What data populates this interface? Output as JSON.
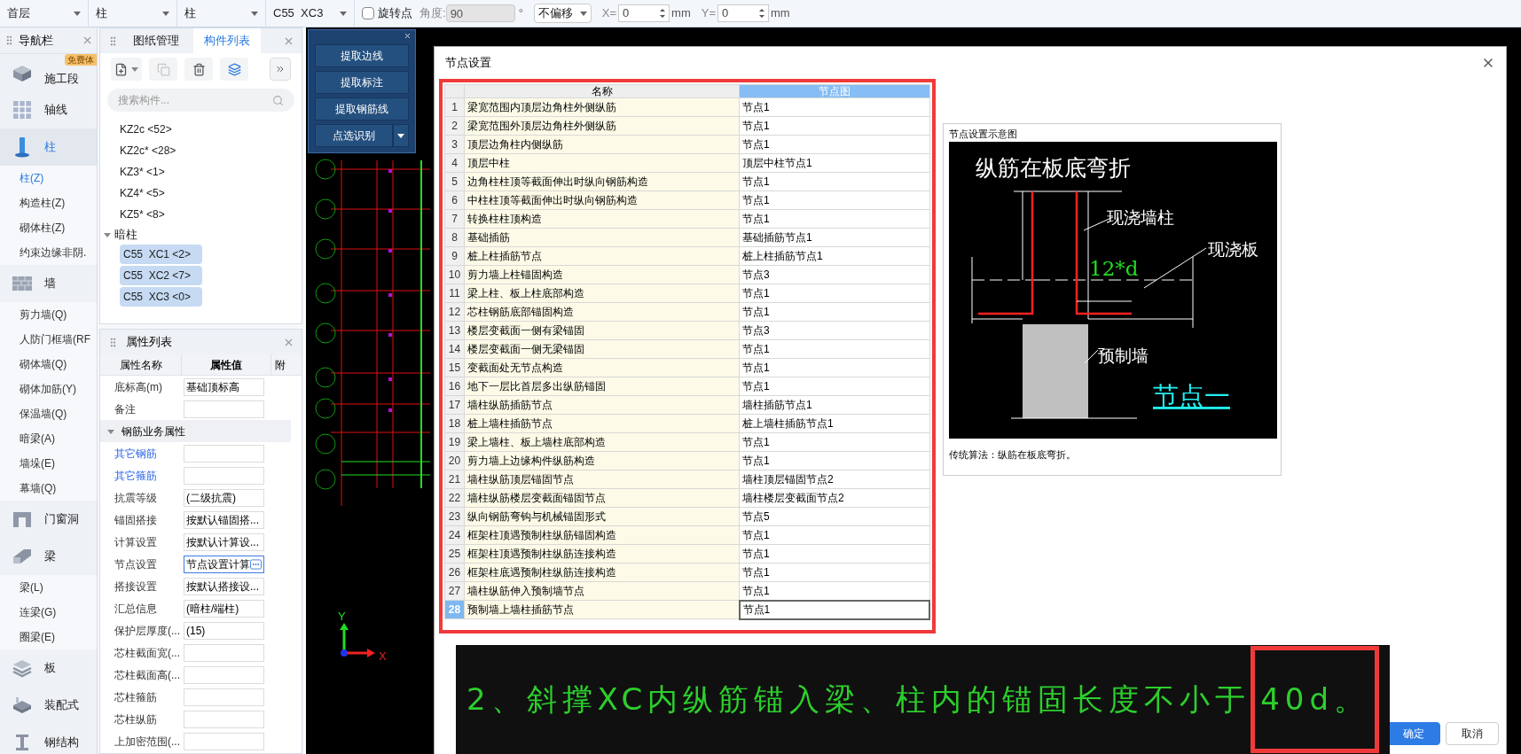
{
  "toolbar": {
    "dropdowns": [
      {
        "value": "首层"
      },
      {
        "value": "柱"
      },
      {
        "value": "柱"
      },
      {
        "value": "C55  XC3"
      }
    ],
    "rotate": {
      "label": "旋转点",
      "checked": false
    },
    "angle": {
      "label": "角度:",
      "value": "90",
      "disabled": true,
      "unit": "°"
    },
    "offset": {
      "value": "不偏移"
    },
    "coords": [
      {
        "label": "X=",
        "value": "0",
        "unit": "mm"
      },
      {
        "label": "Y=",
        "value": "0",
        "unit": "mm"
      }
    ]
  },
  "nav": {
    "title": "导航栏",
    "categories": [
      {
        "label": "施工段",
        "badge": "免费体",
        "selected": false
      },
      {
        "label": "轴线",
        "selected": false
      },
      {
        "label": "柱",
        "selected": true,
        "children": [
          {
            "label": "柱(Z)",
            "selected": true
          },
          {
            "label": "构造柱(Z)",
            "selected": false
          },
          {
            "label": "砌体柱(Z)",
            "selected": false
          },
          {
            "label": "约束边缘非阴.",
            "selected": false
          }
        ]
      },
      {
        "label": "墙",
        "selected": false,
        "children": [
          {
            "label": "剪力墙(Q)",
            "selected": false
          },
          {
            "label": "人防门框墙(RF",
            "selected": false
          },
          {
            "label": "砌体墙(Q)",
            "selected": false
          },
          {
            "label": "砌体加筋(Y)",
            "selected": false
          },
          {
            "label": "保温墙(Q)",
            "selected": false
          },
          {
            "label": "暗梁(A)",
            "selected": false
          },
          {
            "label": "墙垛(E)",
            "selected": false
          },
          {
            "label": "幕墙(Q)",
            "selected": false
          }
        ]
      },
      {
        "label": "门窗洞",
        "selected": false
      },
      {
        "label": "梁",
        "selected": false,
        "children": [
          {
            "label": "梁(L)",
            "selected": false
          },
          {
            "label": "连梁(G)",
            "selected": false
          },
          {
            "label": "圈梁(E)",
            "selected": false
          }
        ]
      },
      {
        "label": "板",
        "selected": false
      },
      {
        "label": "装配式",
        "selected": false
      },
      {
        "label": "钢结构",
        "selected": false
      }
    ]
  },
  "component_panel": {
    "tabs": [
      {
        "label": "图纸管理",
        "selected": false
      },
      {
        "label": "构件列表",
        "selected": true
      }
    ],
    "search": {
      "placeholder": "搜索构件..."
    },
    "items": [
      {
        "label": "KZ2c <52>"
      },
      {
        "label": "KZ2c* <28>"
      },
      {
        "label": "KZ3* <1>"
      },
      {
        "label": "KZ4* <5>"
      },
      {
        "label": "KZ5* <8>"
      }
    ],
    "groups": [
      {
        "label": "暗柱",
        "expanded": true,
        "children": [
          {
            "label": "C55  XC1 <2>",
            "selected": true
          },
          {
            "label": "C55  XC2 <7>",
            "selected": true
          },
          {
            "label": "C55  XC3 <0>",
            "selected": true
          }
        ]
      }
    ]
  },
  "properties": {
    "title": "属性列表",
    "columns": [
      "属性名称",
      "属性值",
      "附"
    ],
    "rows": [
      {
        "kind": "field",
        "name": "底标高(m)",
        "value": "基础顶标高",
        "link": false,
        "focused": false
      },
      {
        "kind": "field",
        "name": "备注",
        "link": false,
        "focused": false
      },
      {
        "kind": "group",
        "label": "钢筋业务属性",
        "expanded": true
      },
      {
        "kind": "field",
        "name": "其它钢筋",
        "link": true,
        "focused": false
      },
      {
        "kind": "field",
        "name": "其它箍筋",
        "link": true,
        "focused": false
      },
      {
        "kind": "field",
        "name": "抗震等级",
        "value": "(二级抗震)",
        "link": false,
        "focused": false
      },
      {
        "kind": "field",
        "name": "锚固搭接",
        "value": "按默认锚固搭...",
        "link": false,
        "focused": false
      },
      {
        "kind": "field",
        "name": "计算设置",
        "value": "按默认计算设...",
        "link": false,
        "focused": false
      },
      {
        "kind": "field",
        "name": "节点设置",
        "value": "节点设置计算",
        "link": false,
        "focused": true
      },
      {
        "kind": "field",
        "name": "搭接设置",
        "value": "按默认搭接设...",
        "link": false,
        "focused": false
      },
      {
        "kind": "field",
        "name": "汇总信息",
        "value": "(暗柱/端柱)",
        "link": false,
        "focused": false
      },
      {
        "kind": "field",
        "name": "保护层厚度(...",
        "value": "(15)",
        "link": false,
        "focused": false
      },
      {
        "kind": "field",
        "name": "芯柱截面宽(...",
        "link": false,
        "focused": false
      },
      {
        "kind": "field",
        "name": "芯柱截面高(...",
        "link": false,
        "focused": false
      },
      {
        "kind": "field",
        "name": "芯柱箍筋",
        "link": false,
        "focused": false
      },
      {
        "kind": "field",
        "name": "芯柱纵筋",
        "link": false,
        "focused": false
      },
      {
        "kind": "field",
        "name": "上加密范围(...",
        "link": false,
        "focused": false
      }
    ]
  },
  "toolbox": {
    "buttons": [
      {
        "label": "提取边线",
        "kind": "plain"
      },
      {
        "label": "提取标注",
        "kind": "plain"
      },
      {
        "label": "提取钢筋线",
        "kind": "plain"
      },
      {
        "label": "点选识别",
        "kind": "split"
      }
    ]
  },
  "canvas": {
    "axis_labels": [
      "Y",
      "X"
    ]
  },
  "dialog": {
    "title": "节点设置",
    "table": {
      "columns": [
        "名称",
        "节点图"
      ],
      "rows": [
        {
          "number": "1",
          "name": "梁宽范围内顶层边角柱外侧纵筋",
          "node": "节点1",
          "selected": false
        },
        {
          "number": "2",
          "name": "梁宽范围外顶层边角柱外侧纵筋",
          "node": "节点1",
          "selected": false
        },
        {
          "number": "3",
          "name": "顶层边角柱内侧纵筋",
          "node": "节点1",
          "selected": false
        },
        {
          "number": "4",
          "name": "顶层中柱",
          "node": "顶层中柱节点1",
          "selected": false
        },
        {
          "number": "5",
          "name": "边角柱柱顶等截面伸出时纵向钢筋构造",
          "node": "节点1",
          "selected": false
        },
        {
          "number": "6",
          "name": "中柱柱顶等截面伸出时纵向钢筋构造",
          "node": "节点1",
          "selected": false
        },
        {
          "number": "7",
          "name": "转换柱柱顶构造",
          "node": "节点1",
          "selected": false
        },
        {
          "number": "8",
          "name": "基础插筋",
          "node": "基础插筋节点1",
          "selected": false
        },
        {
          "number": "9",
          "name": "桩上柱插筋节点",
          "node": "桩上柱插筋节点1",
          "selected": false
        },
        {
          "number": "10",
          "name": "剪力墙上柱锚固构造",
          "node": "节点3",
          "selected": false
        },
        {
          "number": "11",
          "name": "梁上柱、板上柱底部构造",
          "node": "节点1",
          "selected": false
        },
        {
          "number": "12",
          "name": "芯柱钢筋底部锚固构造",
          "node": "节点1",
          "selected": false
        },
        {
          "number": "13",
          "name": "楼层变截面一侧有梁锚固",
          "node": "节点3",
          "selected": false
        },
        {
          "number": "14",
          "name": "楼层变截面一侧无梁锚固",
          "node": "节点1",
          "selected": false
        },
        {
          "number": "15",
          "name": "变截面处无节点构造",
          "node": "节点1",
          "selected": false
        },
        {
          "number": "16",
          "name": "地下一层比首层多出纵筋锚固",
          "node": "节点1",
          "selected": false
        },
        {
          "number": "17",
          "name": "墙柱纵筋插筋节点",
          "node": "墙柱插筋节点1",
          "selected": false
        },
        {
          "number": "18",
          "name": "桩上墙柱插筋节点",
          "node": "桩上墙柱插筋节点1",
          "selected": false
        },
        {
          "number": "19",
          "name": "梁上墙柱、板上墙柱底部构造",
          "node": "节点1",
          "selected": false
        },
        {
          "number": "20",
          "name": "剪力墙上边缘构件纵筋构造",
          "node": "节点1",
          "selected": false
        },
        {
          "number": "21",
          "name": "墙柱纵筋顶层锚固节点",
          "node": "墙柱顶层锚固节点2",
          "selected": false
        },
        {
          "number": "22",
          "name": "墙柱纵筋楼层变截面锚固节点",
          "node": "墙柱楼层变截面节点2",
          "selected": false
        },
        {
          "number": "23",
          "name": "纵向钢筋弯钩与机械锚固形式",
          "node": "节点5",
          "selected": false
        },
        {
          "number": "24",
          "name": "框架柱顶遇预制柱纵筋锚固构造",
          "node": "节点1",
          "selected": false
        },
        {
          "number": "25",
          "name": "框架柱顶遇预制柱纵筋连接构造",
          "node": "节点1",
          "selected": false
        },
        {
          "number": "26",
          "name": "框架柱底遇预制柱纵筋连接构造",
          "node": "节点1",
          "selected": false
        },
        {
          "number": "27",
          "name": "墙柱纵筋伸入预制墙节点",
          "node": "节点1",
          "selected": false
        },
        {
          "number": "28",
          "name": "预制墙上墙柱插筋节点",
          "node": "节点1",
          "selected": true
        }
      ]
    },
    "preview": {
      "title": "节点设置示意图",
      "diagram": {
        "heading": "纵筋在板底弯折",
        "labels": [
          "现浇墙柱",
          "现浇板",
          "预制墙"
        ],
        "dimension": "12*d",
        "node_name": "节点一"
      },
      "caption": "传统算法：纵筋在板底弯折。"
    },
    "buttons": [
      {
        "label": "确定",
        "primary": true
      },
      {
        "label": "取消",
        "primary": false
      }
    ]
  },
  "subtitle": {
    "text": "2、斜撑XC内纵筋锚入梁、柱内的锚固长度不小于",
    "highlighted": "40d。"
  }
}
